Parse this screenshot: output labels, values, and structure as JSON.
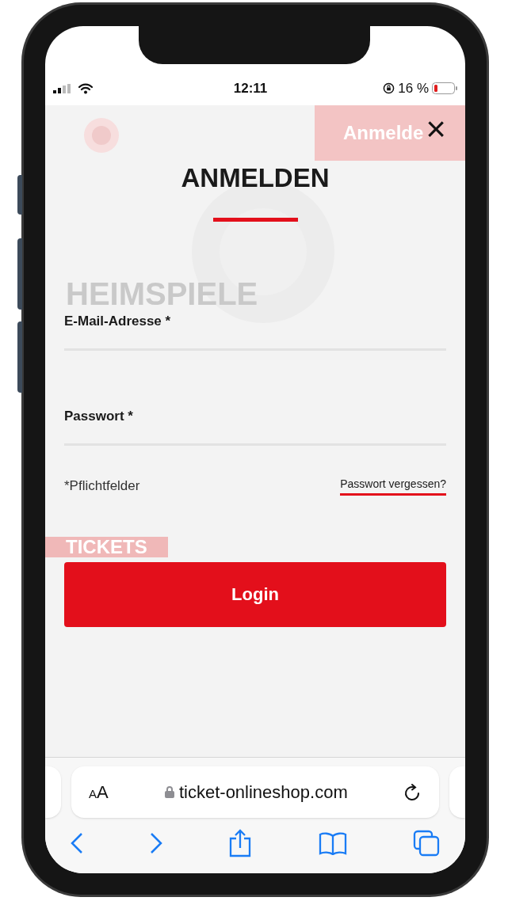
{
  "status_bar": {
    "time": "12:11",
    "battery": "16 %"
  },
  "background": {
    "header_button": "Anmelde",
    "headline": "HEIMSPIELE",
    "tag": "TICKETS"
  },
  "dialog": {
    "close": "×",
    "title": "ANMELDEN",
    "fields": [
      {
        "label": "E-Mail-Adresse *"
      },
      {
        "label": "Passwort *"
      }
    ],
    "required_note": "*Pflichtfelder",
    "forgot_link": "Passwort vergessen?",
    "submit": "Login"
  },
  "browser": {
    "text_size": "AA",
    "url": "ticket-onlineshop.com"
  }
}
